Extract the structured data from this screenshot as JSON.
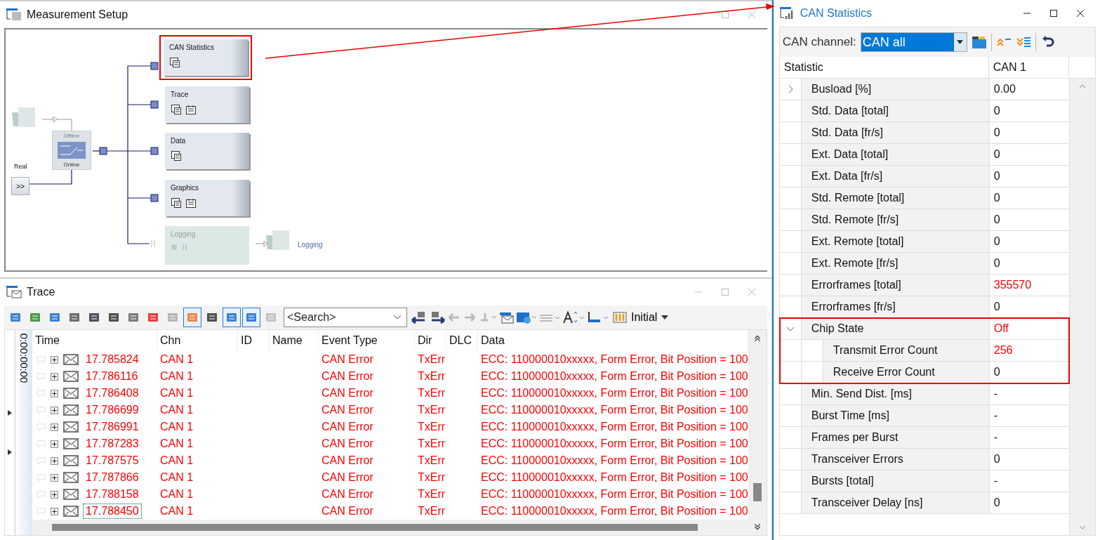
{
  "measurement_setup": {
    "title": "Measurement Setup",
    "sources": {
      "real_label": "Real",
      "real_button": ">>",
      "offline_label": "Offline",
      "online_label": "Online",
      "online": true
    },
    "blocks": [
      {
        "label": "CAN Statistics",
        "enabled": true,
        "highlighted": true
      },
      {
        "label": "Trace",
        "enabled": true,
        "highlighted": false
      },
      {
        "label": "Data",
        "enabled": true,
        "highlighted": false
      },
      {
        "label": "Graphics",
        "enabled": true,
        "highlighted": false
      },
      {
        "label": "Logging",
        "enabled": false,
        "highlighted": false
      }
    ],
    "sink_label": "Logging"
  },
  "trace": {
    "title": "Trace",
    "toolbar_buttons": [
      {
        "pressed": false
      },
      {
        "pressed": false
      },
      {
        "pressed": false
      },
      {
        "pressed": false
      },
      {
        "pressed": false
      },
      {
        "pressed": false
      },
      {
        "pressed": false
      },
      {
        "pressed": false
      },
      {
        "pressed": false
      },
      {
        "pressed": true
      },
      {
        "pressed": false
      },
      {
        "pressed": true
      },
      {
        "pressed": true
      },
      {
        "pressed": false
      }
    ],
    "search": {
      "placeholder": "<Search>"
    },
    "layout_button": "Initial",
    "time_label": "0:00:00:00",
    "columns": [
      "Time",
      "Chn",
      "ID",
      "Name",
      "Event Type",
      "Dir",
      "DLC",
      "Data"
    ],
    "rows": [
      {
        "time": "17.785824",
        "chn": "CAN 1",
        "event_type": "CAN Error",
        "dir": "TxErr",
        "data": "ECC: 110000010xxxxx, Form Error, Bit Position = 100",
        "selected": false
      },
      {
        "time": "17.786116",
        "chn": "CAN 1",
        "event_type": "CAN Error",
        "dir": "TxErr",
        "data": "ECC: 110000010xxxxx, Form Error, Bit Position = 100",
        "selected": false
      },
      {
        "time": "17.786408",
        "chn": "CAN 1",
        "event_type": "CAN Error",
        "dir": "TxErr",
        "data": "ECC: 110000010xxxxx, Form Error, Bit Position = 100",
        "selected": false
      },
      {
        "time": "17.786699",
        "chn": "CAN 1",
        "event_type": "CAN Error",
        "dir": "TxErr",
        "data": "ECC: 110000010xxxxx, Form Error, Bit Position = 100",
        "selected": false
      },
      {
        "time": "17.786991",
        "chn": "CAN 1",
        "event_type": "CAN Error",
        "dir": "TxErr",
        "data": "ECC: 110000010xxxxx, Form Error, Bit Position = 100",
        "selected": false
      },
      {
        "time": "17.787283",
        "chn": "CAN 1",
        "event_type": "CAN Error",
        "dir": "TxErr",
        "data": "ECC: 110000010xxxxx, Form Error, Bit Position = 100",
        "selected": false
      },
      {
        "time": "17.787575",
        "chn": "CAN 1",
        "event_type": "CAN Error",
        "dir": "TxErr",
        "data": "ECC: 110000010xxxxx, Form Error, Bit Position = 100",
        "selected": false
      },
      {
        "time": "17.787866",
        "chn": "CAN 1",
        "event_type": "CAN Error",
        "dir": "TxErr",
        "data": "ECC: 110000010xxxxx, Form Error, Bit Position = 100",
        "selected": false
      },
      {
        "time": "17.788158",
        "chn": "CAN 1",
        "event_type": "CAN Error",
        "dir": "TxErr",
        "data": "ECC: 110000010xxxxx, Form Error, Bit Position = 100",
        "selected": false
      },
      {
        "time": "17.788450",
        "chn": "CAN 1",
        "event_type": "CAN Error",
        "dir": "TxErr",
        "data": "ECC: 110000010xxxxx, Form Error, Bit Position = 100",
        "selected": true
      }
    ]
  },
  "can_statistics": {
    "title": "CAN Statistics",
    "channel_label": "CAN channel:",
    "channel_value": "CAN all",
    "columns": [
      "Statistic",
      "CAN 1"
    ],
    "rows": [
      {
        "name": "Busload [%]",
        "value": "0.00",
        "expanded": false,
        "alert": false
      },
      {
        "name": "Std. Data [total]",
        "value": "0",
        "alert": false
      },
      {
        "name": "Std. Data [fr/s]",
        "value": "0",
        "alert": false
      },
      {
        "name": "Ext. Data [total]",
        "value": "0",
        "alert": false
      },
      {
        "name": "Ext. Data [fr/s]",
        "value": "0",
        "alert": false
      },
      {
        "name": "Std. Remote [total]",
        "value": "0",
        "alert": false
      },
      {
        "name": "Std. Remote [fr/s]",
        "value": "0",
        "alert": false
      },
      {
        "name": "Ext. Remote [total]",
        "value": "0",
        "alert": false
      },
      {
        "name": "Ext. Remote [fr/s]",
        "value": "0",
        "alert": false
      },
      {
        "name": "Errorframes [total]",
        "value": "355570",
        "alert": true
      },
      {
        "name": "Errorframes [fr/s]",
        "value": "0",
        "alert": false
      },
      {
        "name": "Chip State",
        "value": "Off",
        "expanded": true,
        "alert": true,
        "highlighted": true,
        "children": [
          {
            "name": "Transmit Error Count",
            "value": "256",
            "alert": true
          },
          {
            "name": "Receive Error Count",
            "value": "0",
            "alert": false
          }
        ]
      },
      {
        "name": "Min. Send Dist. [ms]",
        "value": "-",
        "alert": false
      },
      {
        "name": "Burst Time [ms]",
        "value": "-",
        "alert": false
      },
      {
        "name": "Frames per Burst",
        "value": "-",
        "alert": false
      },
      {
        "name": "Transceiver Errors",
        "value": "0",
        "alert": false
      },
      {
        "name": "Bursts [total]",
        "value": "-",
        "alert": false
      },
      {
        "name": "Transceiver Delay [ns]",
        "value": "0",
        "alert": false
      }
    ]
  }
}
